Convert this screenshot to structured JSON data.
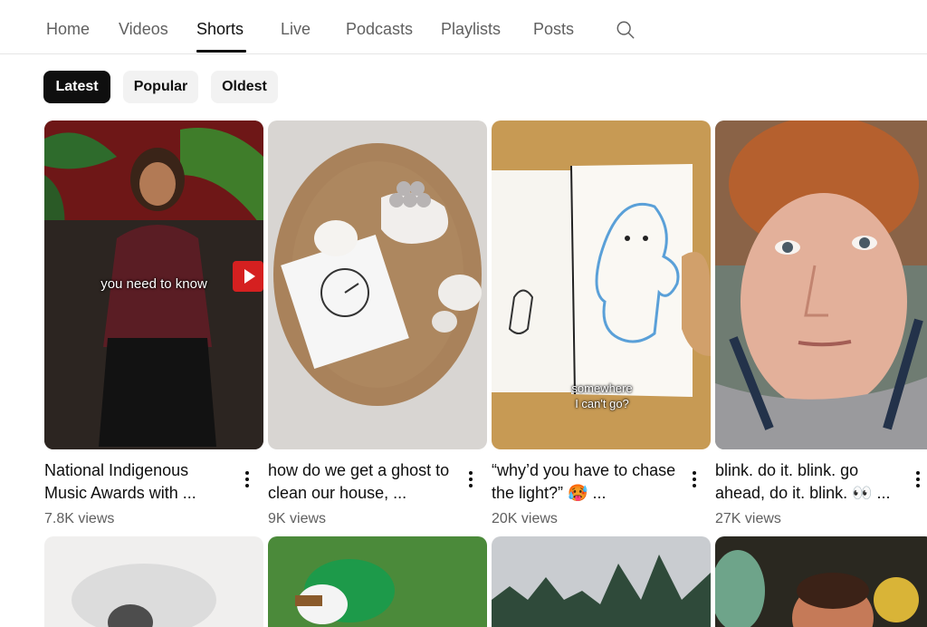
{
  "tabs": [
    {
      "label": "Home"
    },
    {
      "label": "Videos"
    },
    {
      "label": "Shorts"
    },
    {
      "label": "Live"
    },
    {
      "label": "Podcasts"
    },
    {
      "label": "Playlists"
    },
    {
      "label": "Posts"
    }
  ],
  "active_tab": "Shorts",
  "search_icon": "search-icon",
  "chips": [
    {
      "label": "Latest"
    },
    {
      "label": "Popular"
    },
    {
      "label": "Oldest"
    }
  ],
  "active_chip": "Latest",
  "shorts": [
    {
      "title": "National Indigenous Music Awards with ...",
      "views": "7.8K views",
      "overlay": "you need to know"
    },
    {
      "title": "how do we get a ghost to clean our house, ...",
      "views": "9K views",
      "overlay": ""
    },
    {
      "title": "“why’d you have to chase the light?” 🥵 ...",
      "views": "20K views",
      "overlay": "somewhere\nI can't go?"
    },
    {
      "title": "blink. do it. blink. go ahead, do it. blink. 👀 ...",
      "views": "27K views",
      "overlay": ""
    }
  ],
  "colors": {
    "text_primary": "#0f0f0f",
    "text_secondary": "#606060",
    "chip_bg": "#f2f2f2",
    "chip_active_bg": "#0f0f0f"
  }
}
